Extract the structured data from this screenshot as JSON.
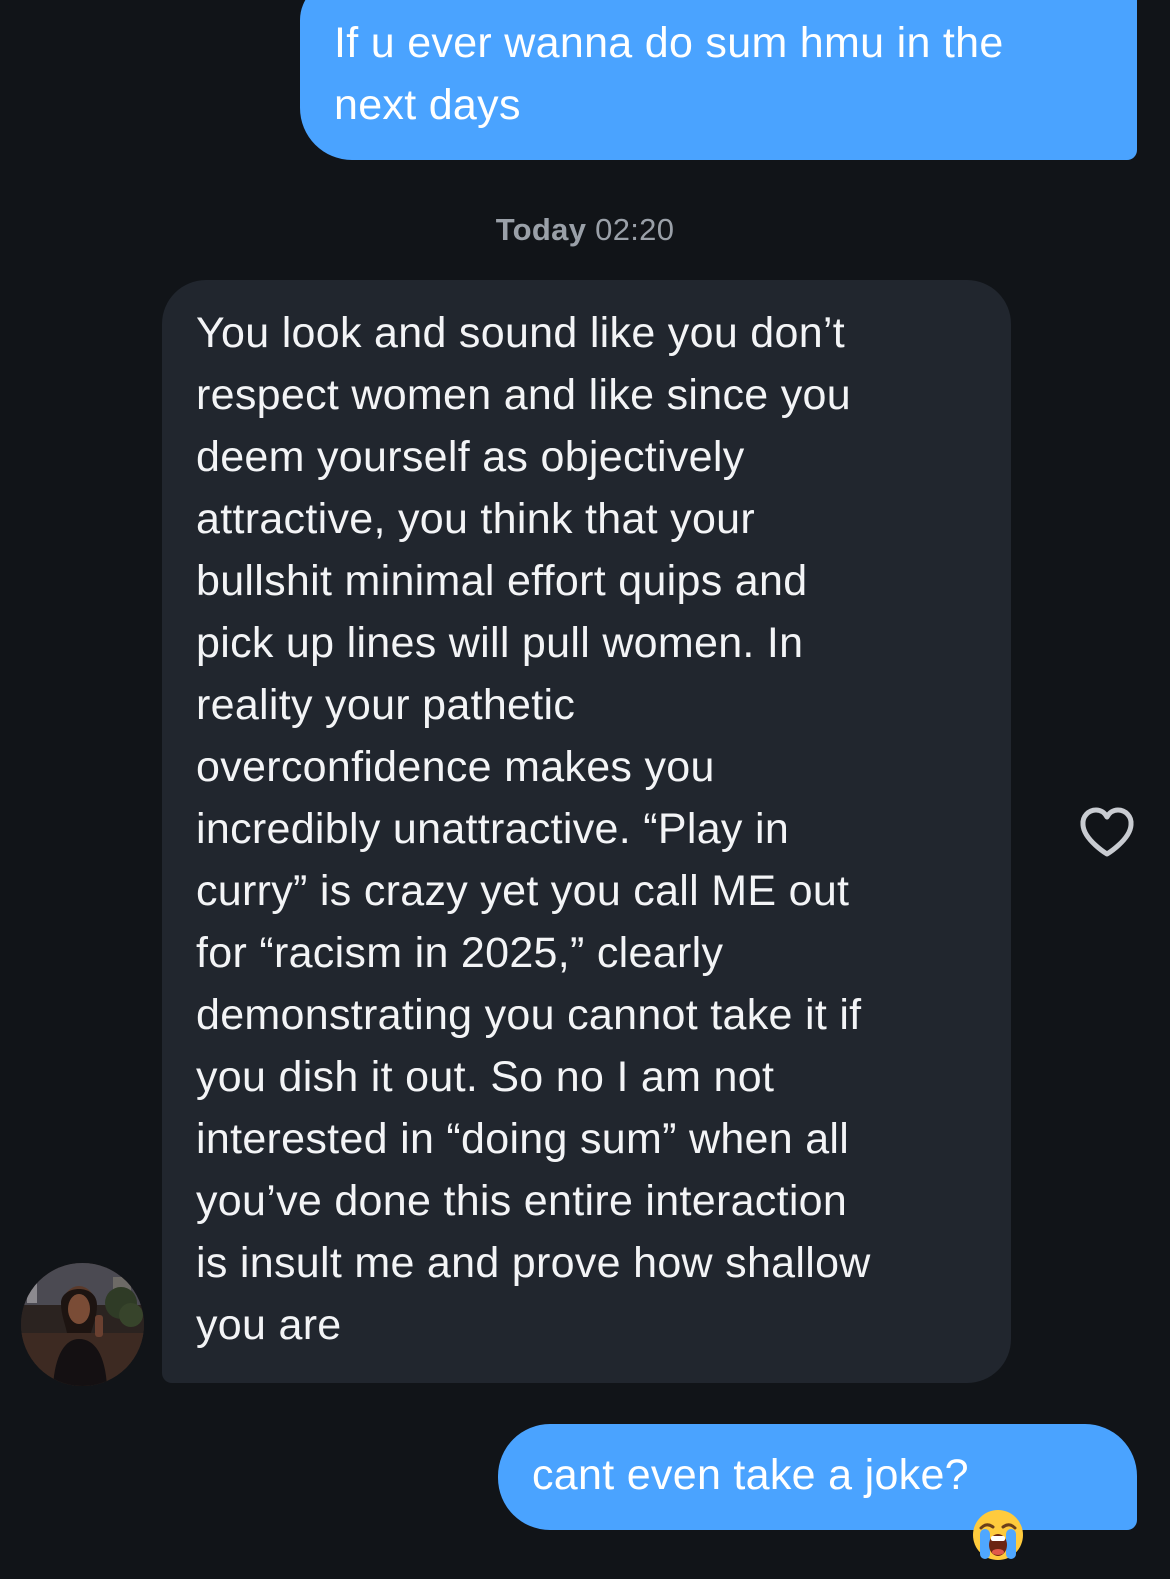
{
  "conversation": {
    "messages": [
      {
        "direction": "sent",
        "text": "If u ever wanna do sum hmu in the\nnext days"
      },
      {
        "direction": "received",
        "text": "You look and sound like you don’t\nrespect women and like since you\ndeem yourself as objectively\nattractive, you think that your\nbullshit minimal effort quips and\npick up lines will pull women. In\nreality your pathetic\noverconfidence makes you\nincredibly unattractive. “Play in\ncurry” is crazy yet you call ME out\nfor “racism in 2025,” clearly\ndemonstrating you cannot take it if\nyou dish it out. So no I am not\ninterested in “doing sum” when all\nyou’ve done this entire interaction\nis insult me and prove how shallow\nyou are"
      },
      {
        "direction": "sent",
        "text": "cant even take a joke?",
        "emoji": "loudly-crying-face-icon"
      }
    ],
    "timestamp": {
      "day": "Today",
      "time": "02:20"
    }
  },
  "icons": {
    "like": "heart-outline-icon",
    "avatar": "contact-avatar"
  },
  "colors": {
    "background": "#111418",
    "sent_bubble": "#4aa3ff",
    "received_bubble": "#21262e",
    "timestamp_text": "#9aa0a8",
    "heart_outline": "#c9ccd1"
  }
}
